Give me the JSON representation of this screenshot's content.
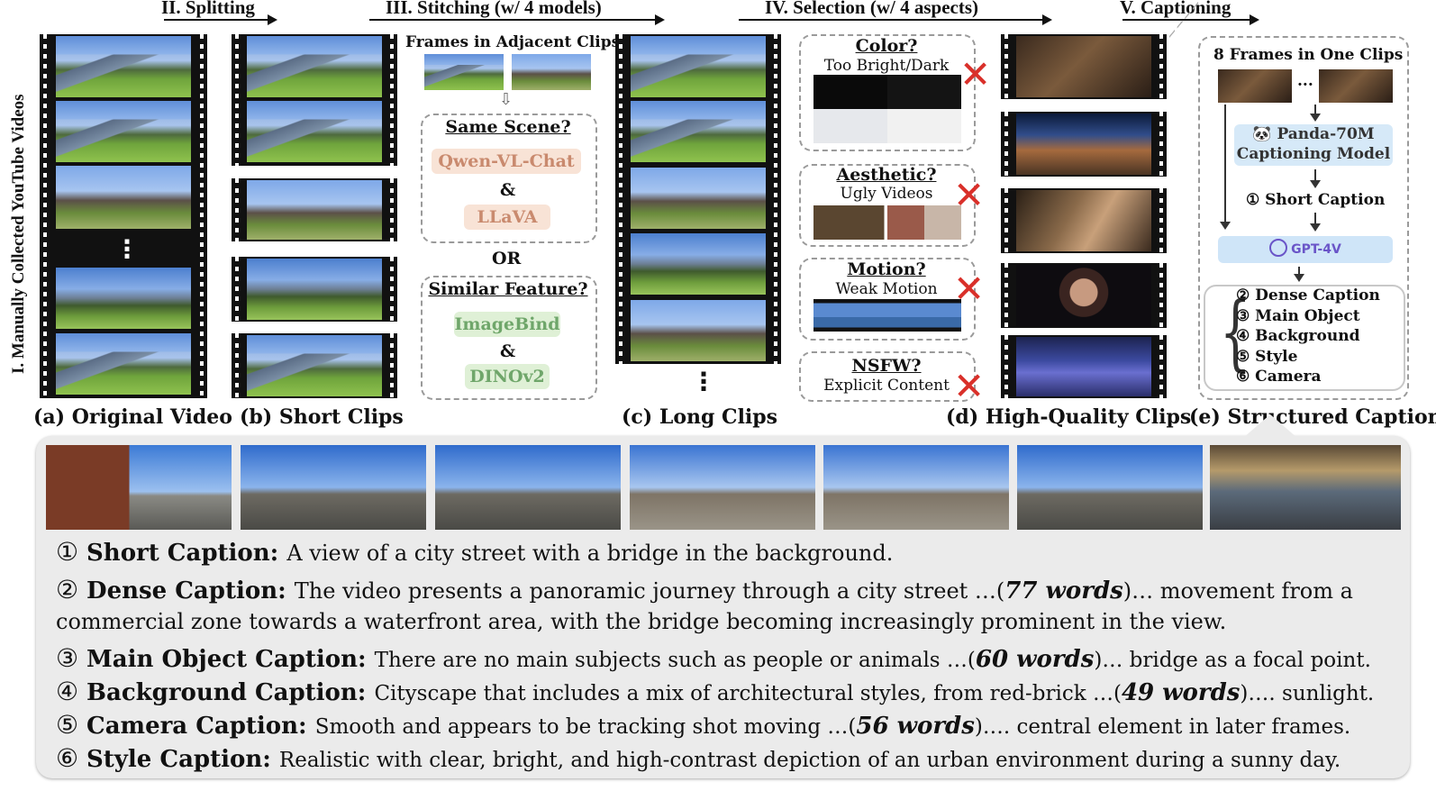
{
  "stages": {
    "splitting": "II. Splitting",
    "stitching": "III. Stitching (w/ 4 models)",
    "selection": "IV. Selection (w/ 4 aspects)",
    "captioning": "V. Captioning",
    "collection": "I. Manually Collected YouTube Videos"
  },
  "panel_labels": {
    "a": "(a) Original Video",
    "b": "(b) Short Clips",
    "c": "(c) Long Clips",
    "d": "(d) High-Quality Clips",
    "e": "(e) Structured Caption"
  },
  "stitching": {
    "frames_title": "Frames in Adjacent Clips",
    "same_scene": "Same Scene?",
    "model1": "Qwen-VL-Chat",
    "amp1": "&",
    "model2": "LLaVA",
    "or": "OR",
    "similar": "Similar Feature?",
    "model3": "ImageBind",
    "amp2": "&",
    "model4": "DINOv2"
  },
  "selection": {
    "color_title": "Color?",
    "color_sub": "Too Bright/Dark",
    "aesthetic_title": "Aesthetic?",
    "aesthetic_sub": "Ugly Videos",
    "motion_title": "Motion?",
    "motion_sub": "Weak Motion",
    "nsfw_title": "NSFW?",
    "nsfw_sub": "Explicit Content",
    "cross_glyph": "✕"
  },
  "captioning": {
    "frames_title": "8 Frames in One Clips",
    "ellipsis": "...",
    "panda_icon": "🐼",
    "panda_line1": "Panda-70M",
    "panda_line2": "Captioning Model",
    "short_caption": "① Short Caption",
    "gpt_label": "GPT-4V",
    "items": [
      "② Dense Caption",
      "③ Main Object",
      "④ Background",
      "⑤ Style",
      "⑥ Camera"
    ]
  },
  "ellipsis_dots": "⋮",
  "captions": [
    {
      "num": "①",
      "label": "Short Caption:",
      "text": "A view of a city street with a bridge in the background."
    },
    {
      "num": "②",
      "label": "Dense Caption:",
      "text_pre": "The video presents a panoramic journey through a city street …(",
      "words": "77 words",
      "text_post": ")… movement from a"
    },
    {
      "cont": "commercial zone towards a waterfront area, with the bridge becoming increasingly prominent in the view."
    },
    {
      "num": "③",
      "label": "Main Object Caption:",
      "text_pre": "There are no main subjects such as people or animals …(",
      "words": "60 words",
      "text_post": ")… bridge as a focal point."
    },
    {
      "num": "④",
      "label": "Background Caption:",
      "text_pre": "Cityscape that includes a mix of architectural styles, from red-brick …(",
      "words": "49 words",
      "text_post": ")…. sunlight."
    },
    {
      "num": "⑤",
      "label": "Camera Caption:",
      "text_pre": "Smooth and appears to be tracking shot moving …(",
      "words": "56 words",
      "text_post": ")…. central element in later frames."
    },
    {
      "num": "⑥",
      "label": "Style Caption:",
      "text": "Realistic with clear, bright, and high-contrast depiction of an urban environment during a sunny day."
    }
  ],
  "colors": {
    "cross": "#d9302a",
    "qwen_bg": "#f8e3d6",
    "qwen_fg": "#c98a6e",
    "imagebind_bg": "#dff0d6",
    "imagebind_fg": "#6fa66a",
    "panda_bg": "#d6e9f8",
    "gpt_bg": "#cfe5f8",
    "panel_bg": "#ebebeb"
  }
}
